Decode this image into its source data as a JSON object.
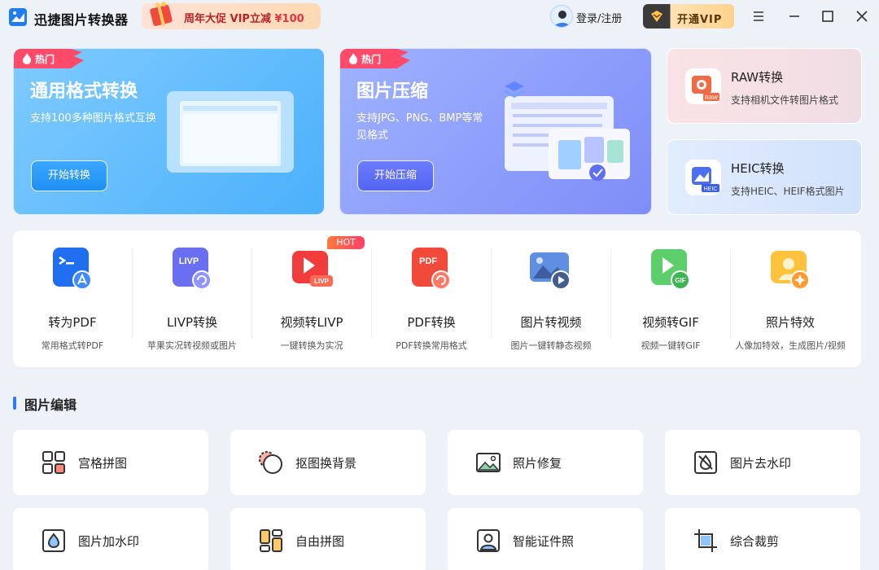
{
  "app": {
    "title": "迅捷图片转换器"
  },
  "promo": {
    "text": "周年大促 VIP立减",
    "price": "¥100"
  },
  "header": {
    "login_label": "登录/注册",
    "vip_label": "开通VIP"
  },
  "banners": [
    {
      "tag": "热门",
      "title": "通用格式转换",
      "desc": "支持100多种图片格式互换",
      "button": "开始转换",
      "color": "#4bb0fb"
    },
    {
      "tag": "热门",
      "title": "图片压缩",
      "desc": "支持JPG、PNG、BMP等常见格式",
      "button": "开始压缩",
      "color": "#7f8df8"
    }
  ],
  "side_cards": [
    {
      "title": "RAW转换",
      "desc": "支持相机文件转图片格式",
      "icon": "raw-file-icon",
      "icon_badge": "RAW"
    },
    {
      "title": "HEIC转换",
      "desc": "支持HEIC、HEIF格式图片",
      "icon": "heic-file-icon",
      "icon_badge": "HEIC"
    }
  ],
  "tools": {
    "hot_badge": "HOT",
    "items": [
      {
        "name": "转为PDF",
        "desc": "常用格式转PDF",
        "icon": "to-pdf-icon"
      },
      {
        "name": "LIVP转换",
        "desc": "苹果实况转视频或图片",
        "icon": "livp-icon",
        "icon_text": "LIVP"
      },
      {
        "name": "视频转LIVP",
        "desc": "一键转换为实况",
        "icon": "video-to-livp-icon",
        "icon_text": "LIVP"
      },
      {
        "name": "PDF转换",
        "desc": "PDF转换常用格式",
        "icon": "pdf-convert-icon",
        "icon_text": "PDF"
      },
      {
        "name": "图片转视频",
        "desc": "图片一键转静态视频",
        "icon": "image-to-video-icon"
      },
      {
        "name": "视频转GIF",
        "desc": "视频一键转GIF",
        "icon": "video-to-gif-icon",
        "icon_text": "GIF"
      },
      {
        "name": "照片特效",
        "desc": "人像加特效，生成图片/视频",
        "icon": "photo-effects-icon"
      }
    ]
  },
  "section": {
    "title": "图片编辑"
  },
  "edit_tools": [
    {
      "label": "宫格拼图",
      "icon": "grid-collage-icon"
    },
    {
      "label": "抠图换背景",
      "icon": "cutout-background-icon"
    },
    {
      "label": "照片修复",
      "icon": "photo-repair-icon"
    },
    {
      "label": "图片去水印",
      "icon": "remove-watermark-icon"
    },
    {
      "label": "图片加水印",
      "icon": "add-watermark-icon"
    },
    {
      "label": "自由拼图",
      "icon": "free-collage-icon"
    },
    {
      "label": "智能证件照",
      "icon": "id-photo-icon"
    },
    {
      "label": "综合裁剪",
      "icon": "crop-icon"
    }
  ],
  "colors": {
    "accent": "#2f7bf6",
    "background": "#edf1f8",
    "hot": "#ff3f6a"
  }
}
